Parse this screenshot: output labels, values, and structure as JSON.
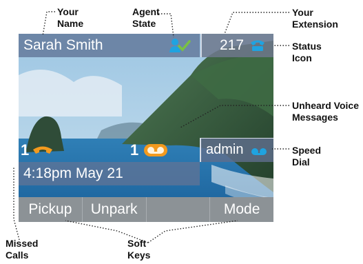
{
  "callouts": {
    "your_name": [
      "Your",
      "Name"
    ],
    "agent_state": [
      "Agent",
      "State"
    ],
    "your_extension": [
      "Your",
      "Extension"
    ],
    "status_icon": [
      "Status",
      "Icon"
    ],
    "unheard_voice_messages": [
      "Unheard Voice",
      "Messages"
    ],
    "speed_dial": [
      "Speed",
      "Dial"
    ],
    "missed_calls": [
      "Missed",
      "Calls"
    ],
    "soft_keys": [
      "Soft",
      "Keys"
    ]
  },
  "phone": {
    "user_name": "Sarah Smith",
    "extension": "217",
    "missed_calls_count": "1",
    "voice_messages_count": "1",
    "speed_dial_label": "admin",
    "datetime": "4:18pm May 21",
    "softkeys": [
      "Pickup",
      "Unpark",
      "",
      "Mode"
    ]
  },
  "icons": {
    "agent_state": "agent-available-icon",
    "status": "phone-handset-icon",
    "missed_calls": "missed-call-handset-icon",
    "voice_message": "voicemail-icon",
    "speed_dial": "voicemail-speed-dial-icon"
  },
  "colors": {
    "accent_blue": "#1fa3e0",
    "accent_orange": "#f39a1e",
    "agent_check": "#7ac142"
  }
}
